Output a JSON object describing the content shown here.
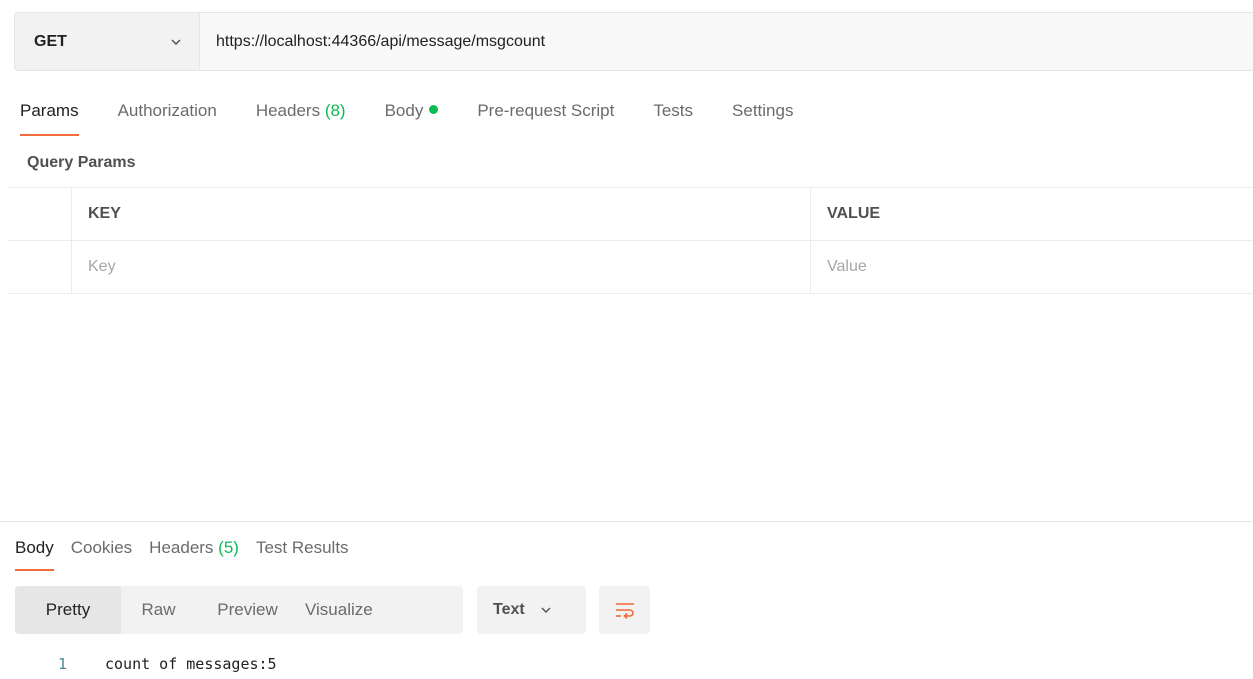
{
  "request": {
    "method": "GET",
    "url": "https://localhost:44366/api/message/msgcount"
  },
  "request_tabs": [
    {
      "label": "Params",
      "count": "",
      "active": true
    },
    {
      "label": "Authorization",
      "count": ""
    },
    {
      "label": "Headers",
      "count": "(8)"
    },
    {
      "label": "Body",
      "count": "",
      "has_dot": true
    },
    {
      "label": "Pre-request Script",
      "count": ""
    },
    {
      "label": "Tests",
      "count": ""
    },
    {
      "label": "Settings",
      "count": ""
    }
  ],
  "query_params": {
    "title": "Query Params",
    "columns": [
      "KEY",
      "VALUE"
    ],
    "placeholders": {
      "key": "Key",
      "value": "Value"
    }
  },
  "response_tabs": [
    {
      "label": "Body",
      "count": "",
      "active": true
    },
    {
      "label": "Cookies",
      "count": ""
    },
    {
      "label": "Headers",
      "count": "(5)"
    },
    {
      "label": "Test Results",
      "count": ""
    }
  ],
  "view_modes": [
    "Pretty",
    "Raw",
    "Preview",
    "Visualize"
  ],
  "active_view": "Pretty",
  "format": "Text",
  "response_body": {
    "lines": [
      {
        "number": "1",
        "text": "count of messages:5"
      }
    ]
  },
  "colors": {
    "accent": "#f26b3a",
    "count_green": "#0cbb52"
  },
  "icons": {
    "method_dropdown": "chevron-down-icon",
    "format_dropdown": "chevron-down-icon",
    "wrap": "wrap-lines-icon"
  }
}
